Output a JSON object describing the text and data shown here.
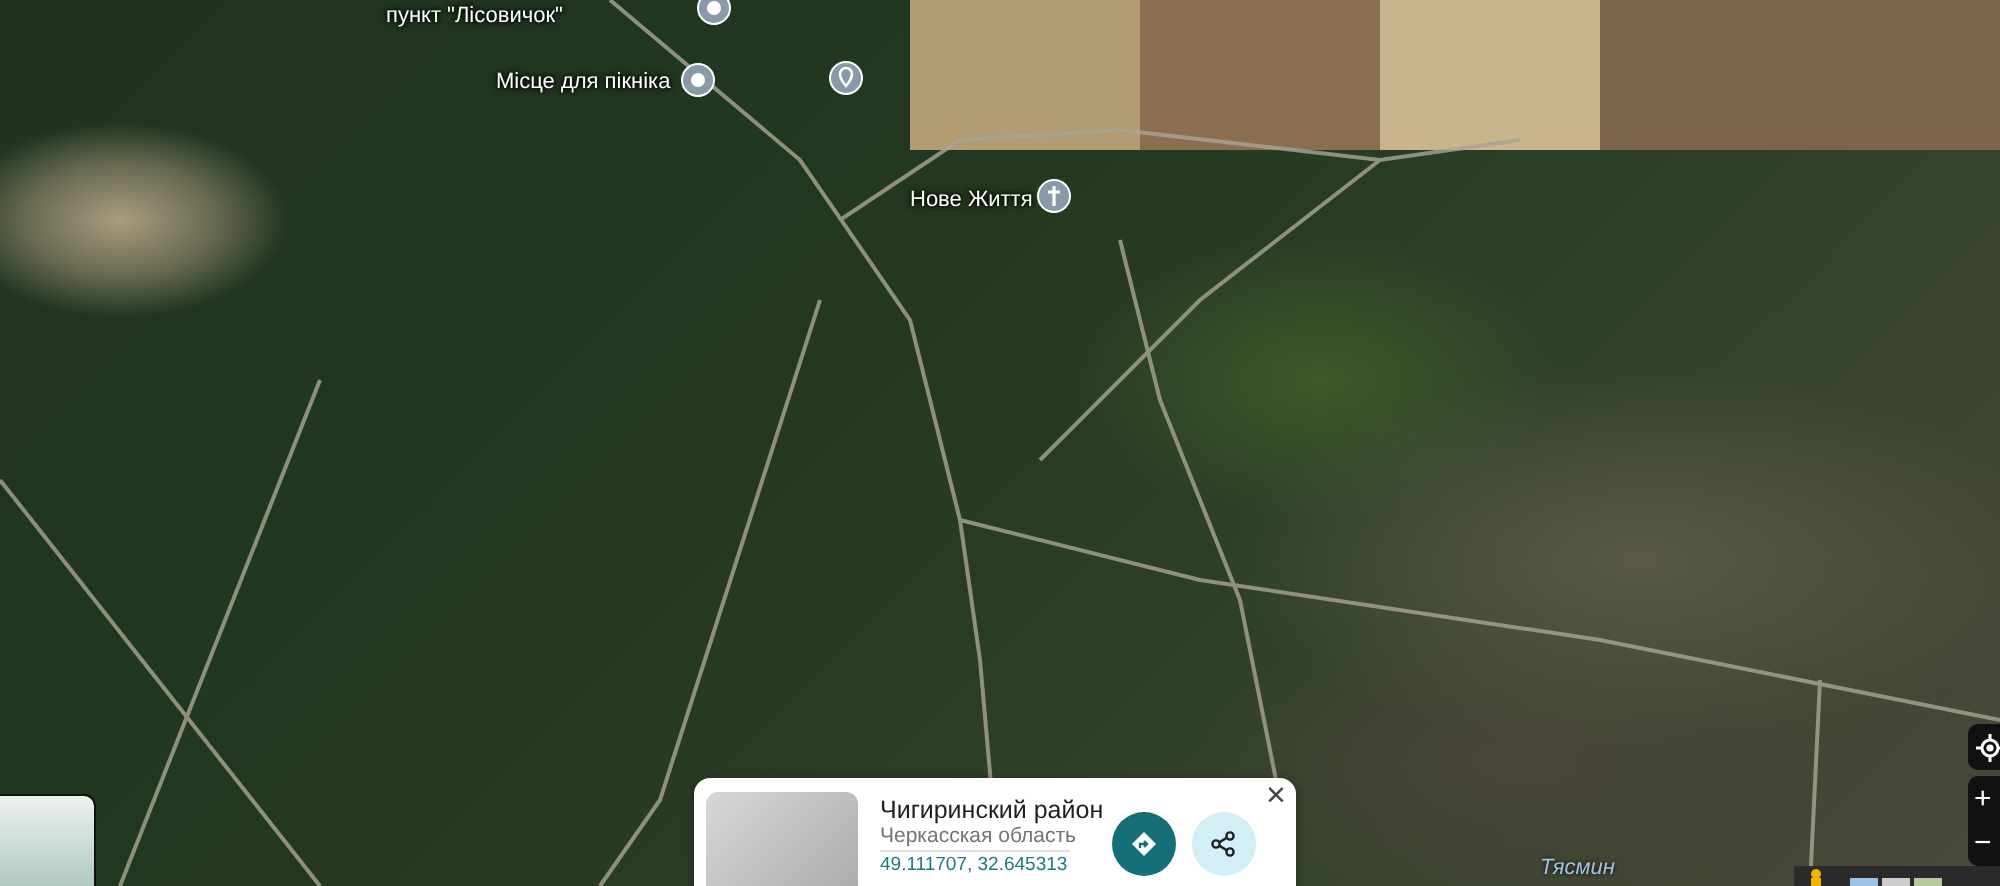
{
  "map": {
    "places": [
      {
        "kind": "dot",
        "label": "пункт \"Лісовичок\""
      },
      {
        "kind": "dot",
        "label": "Місце для пікніка"
      },
      {
        "kind": "pin"
      },
      {
        "kind": "church",
        "label": "Нове Життя"
      },
      {
        "kind": "water",
        "label": "Тясмин"
      }
    ]
  },
  "place_card": {
    "title": "Чигиринский район",
    "subtitle": "Черкасская область",
    "coordinates": "49.111707, 32.645313",
    "close": "×"
  },
  "controls": {
    "zoom_in": "+",
    "zoom_out": "−"
  }
}
